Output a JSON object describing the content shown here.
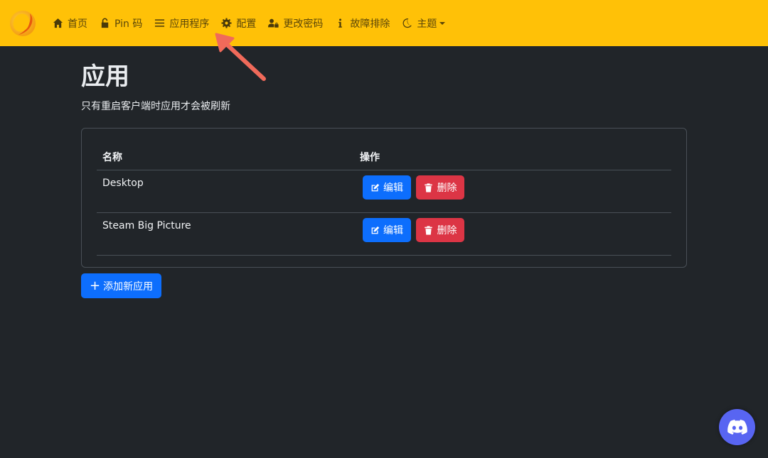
{
  "nav": {
    "items": [
      {
        "label": "首页",
        "icon": "home-icon"
      },
      {
        "label": "Pin 码",
        "icon": "unlock-icon"
      },
      {
        "label": "应用程序",
        "icon": "list-icon"
      },
      {
        "label": "配置",
        "icon": "gear-icon"
      },
      {
        "label": "更改密码",
        "icon": "user-lock-icon"
      },
      {
        "label": "故障排除",
        "icon": "info-icon"
      },
      {
        "label": "主题",
        "icon": "moon-icon"
      }
    ]
  },
  "page": {
    "title": "应用",
    "subtitle": "只有重启客户端时应用才会被刷新"
  },
  "table": {
    "headers": [
      "名称",
      "操作"
    ],
    "rows": [
      {
        "name": "Desktop",
        "edit_label": "编辑",
        "delete_label": "删除"
      },
      {
        "name": "Steam Big Picture",
        "edit_label": "编辑",
        "delete_label": "删除"
      }
    ]
  },
  "actions": {
    "add_label": "添加新应用"
  },
  "colors": {
    "navbar": "#ffc107",
    "background": "#212529",
    "primary": "#0d6efd",
    "danger": "#dc3545",
    "discord": "#5865f2",
    "annotation_arrow": "#f06a5a"
  }
}
